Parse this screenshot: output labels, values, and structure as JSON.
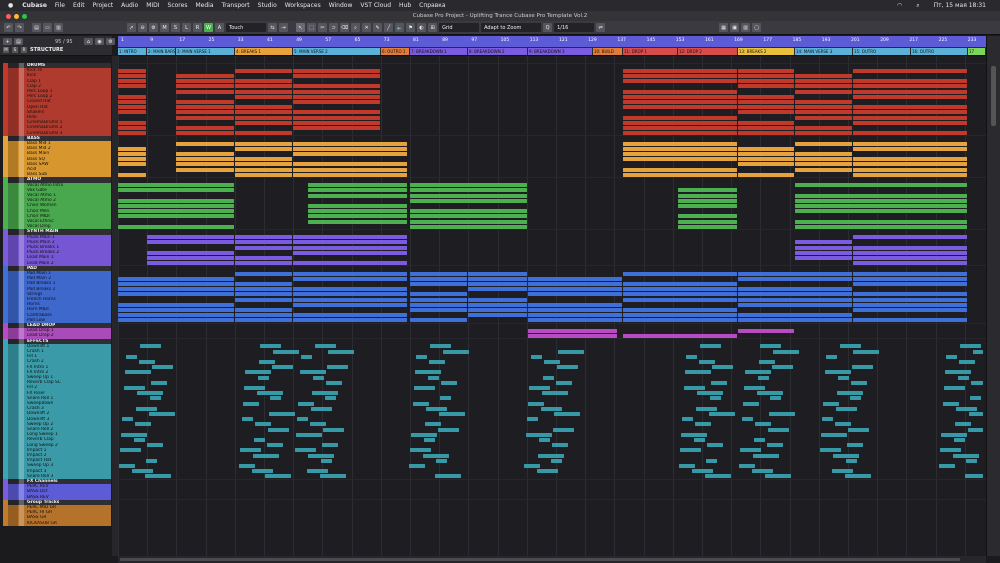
{
  "menubar": {
    "apple": "",
    "app": "Cubase",
    "items": [
      "File",
      "Edit",
      "Project",
      "Audio",
      "MIDI",
      "Scores",
      "Media",
      "Transport",
      "Studio",
      "Workspaces",
      "Window",
      "VST Cloud",
      "Hub",
      "Справка"
    ],
    "clock": "Пт, 15 мая 18:31"
  },
  "window": {
    "title": "Cubase Pro Project - Uplifting Trance Cubase Pro Template Vol.2"
  },
  "toolbar": {
    "automation_mode": "Touch",
    "snap_type": "Grid",
    "zoom_mode": "Adapt to Zoom",
    "quantize": "1/16",
    "buttons": [
      "M",
      "S",
      "L",
      "R",
      "W",
      "A"
    ]
  },
  "tracklist": {
    "count": "95 / 95",
    "header_label": "STRUCTURE"
  },
  "colors": {
    "accent": "#5d5bd6",
    "drums": "#c0392b",
    "bass": "#e6a23c",
    "atmo": "#4caf50",
    "synth": "#7b5be0",
    "pad": "#3f6fd8",
    "lead": "#b84bc4",
    "fx": "#3aa5b5"
  },
  "ruler": {
    "bars": [
      "1",
      "9",
      "17",
      "25",
      "33",
      "41",
      "49",
      "57",
      "65",
      "73",
      "81",
      "89",
      "97",
      "105",
      "113",
      "121",
      "129",
      "137",
      "145",
      "153",
      "161",
      "169",
      "177",
      "185",
      "193",
      "201",
      "209",
      "217",
      "225",
      "233"
    ],
    "markers": [
      {
        "label": "1: INTRO",
        "color": "#5ab0d6"
      },
      {
        "label": "2: MAIN BARS",
        "color": "#5ab0d6"
      },
      {
        "label": "3: MAIN VERSE 1",
        "color": "#5ab0d6"
      },
      {
        "label": "4: BREAKS 1",
        "color": "#e8a23c"
      },
      {
        "label": "5: MAIN VERSE 2",
        "color": "#5ab0d6"
      },
      {
        "label": "6: OUTRO 1",
        "color": "#e07b39"
      },
      {
        "label": "7: BREAKDOWN 1",
        "color": "#7b5be0"
      },
      {
        "label": "8: BREAKDOWN 2",
        "color": "#7b5be0"
      },
      {
        "label": "9: BREAKDOWN 3",
        "color": "#7b5be0"
      },
      {
        "label": "10: BUILD",
        "color": "#e07b39"
      },
      {
        "label": "11: DROP 1",
        "color": "#d84b4b"
      },
      {
        "label": "12: DROP 2",
        "color": "#d84b4b"
      },
      {
        "label": "13: BREAKS 2",
        "color": "#e8c03c"
      },
      {
        "label": "14: MAIN VERSE 3",
        "color": "#5ab0d6"
      },
      {
        "label": "15: OUTRO",
        "color": "#5ab0d6"
      },
      {
        "label": "16: OUTRO",
        "color": "#5ab0d6"
      },
      {
        "label": "17",
        "color": "#7bd65a"
      }
    ]
  },
  "tracks": [
    {
      "name": "DRUMS",
      "group": "drums",
      "folder": true
    },
    {
      "name": "Kick Hi",
      "group": "drums"
    },
    {
      "name": "Kick",
      "group": "drums"
    },
    {
      "name": "Clap 1",
      "group": "drums"
    },
    {
      "name": "Clap 2",
      "group": "drums"
    },
    {
      "name": "Perc Loop 1",
      "group": "drums"
    },
    {
      "name": "Perc Loop 2",
      "group": "drums"
    },
    {
      "name": "Closed Hat",
      "group": "drums"
    },
    {
      "name": "Open Hat",
      "group": "drums"
    },
    {
      "name": "Shakers",
      "group": "drums"
    },
    {
      "name": "Ride",
      "group": "drums"
    },
    {
      "name": "CinemaDrums 1",
      "group": "drums"
    },
    {
      "name": "CinemaDrums 2",
      "group": "drums"
    },
    {
      "name": "CinemaDrums 3",
      "group": "drums"
    },
    {
      "name": "BASS",
      "group": "bass",
      "folder": true
    },
    {
      "name": "Bass Mid 1",
      "group": "bass"
    },
    {
      "name": "Bass Mid 2",
      "group": "bass"
    },
    {
      "name": "Bass Main",
      "group": "bass"
    },
    {
      "name": "Bass SQ",
      "group": "bass"
    },
    {
      "name": "Bass SAW",
      "group": "bass"
    },
    {
      "name": "Acid",
      "group": "bass"
    },
    {
      "name": "Bass Sub",
      "group": "bass"
    },
    {
      "name": "ATMO",
      "group": "atmo",
      "folder": true
    },
    {
      "name": "Vocal Atmo Intro",
      "group": "atmo"
    },
    {
      "name": "Vox Gate",
      "group": "atmo"
    },
    {
      "name": "Vocal Atmo 1",
      "group": "atmo"
    },
    {
      "name": "Vocal Atmo 2",
      "group": "atmo"
    },
    {
      "name": "Choir Women",
      "group": "atmo"
    },
    {
      "name": "Choir Men",
      "group": "atmo"
    },
    {
      "name": "Choir MIDI",
      "group": "atmo"
    },
    {
      "name": "Vocal Ethnic",
      "group": "atmo"
    },
    {
      "name": "Vocal Drop",
      "group": "atmo"
    },
    {
      "name": "SYNTH MAIN",
      "group": "synth",
      "folder": true
    },
    {
      "name": "Pluck Main 1",
      "group": "synth"
    },
    {
      "name": "Pluck Main 2",
      "group": "synth"
    },
    {
      "name": "Pluck Breaks 1",
      "group": "synth"
    },
    {
      "name": "Pluck Breaks 2",
      "group": "synth"
    },
    {
      "name": "Lead Main 1",
      "group": "synth"
    },
    {
      "name": "Lead Main 2",
      "group": "synth"
    },
    {
      "name": "PAD",
      "group": "pad",
      "folder": true
    },
    {
      "name": "Pad Main 1",
      "group": "pad"
    },
    {
      "name": "Pad Main 2",
      "group": "pad"
    },
    {
      "name": "Pad Breaks 1",
      "group": "pad"
    },
    {
      "name": "Pad Breaks 2",
      "group": "pad"
    },
    {
      "name": "Strings",
      "group": "pad"
    },
    {
      "name": "French Horns",
      "group": "pad"
    },
    {
      "name": "Horns",
      "group": "pad"
    },
    {
      "name": "Horn MIDI",
      "group": "pad"
    },
    {
      "name": "Contrabass",
      "group": "pad"
    },
    {
      "name": "Pad Low",
      "group": "pad"
    },
    {
      "name": "LEAD DROP",
      "group": "lead",
      "folder": true
    },
    {
      "name": "Lead Drop 1",
      "group": "lead"
    },
    {
      "name": "Lead Drop 2",
      "group": "lead"
    },
    {
      "name": "EFFECTS",
      "group": "fx",
      "folder": true
    },
    {
      "name": "Downlift 1",
      "group": "fx"
    },
    {
      "name": "Crash 1",
      "group": "fx"
    },
    {
      "name": "Fill 1",
      "group": "fx"
    },
    {
      "name": "Crash 2",
      "group": "fx"
    },
    {
      "name": "FX Intro 1",
      "group": "fx"
    },
    {
      "name": "FX Intro 2",
      "group": "fx"
    },
    {
      "name": "Sweep Up 1",
      "group": "fx"
    },
    {
      "name": "Reverb Clap SC",
      "group": "fx"
    },
    {
      "name": "Fill 2",
      "group": "fx"
    },
    {
      "name": "FX Riser",
      "group": "fx"
    },
    {
      "name": "Snare Roll 1",
      "group": "fx"
    },
    {
      "name": "Sweepdown",
      "group": "fx"
    },
    {
      "name": "Crash 3",
      "group": "fx"
    },
    {
      "name": "Downlift 2",
      "group": "fx"
    },
    {
      "name": "Downlift 3",
      "group": "fx"
    },
    {
      "name": "Sweep Up 2",
      "group": "fx"
    },
    {
      "name": "Snare Roll 2",
      "group": "fx"
    },
    {
      "name": "Long Sweep 1",
      "group": "fx"
    },
    {
      "name": "Reverb Clap",
      "group": "fx"
    },
    {
      "name": "Long Sweep 2",
      "group": "fx"
    },
    {
      "name": "Impact 1",
      "group": "fx"
    },
    {
      "name": "Impact 2",
      "group": "fx"
    },
    {
      "name": "Impact Hat",
      "group": "fx"
    },
    {
      "name": "Sweep Up 3",
      "group": "fx"
    },
    {
      "name": "Impact 3",
      "group": "fx"
    },
    {
      "name": "Snare Roll 3",
      "group": "fx"
    },
    {
      "name": "FX Channels",
      "group": "fxch",
      "folder": true
    },
    {
      "name": "PERC REV",
      "group": "fxch"
    },
    {
      "name": "BASS DLY",
      "group": "fxch"
    },
    {
      "name": "BASS REV",
      "group": "fxch"
    },
    {
      "name": "Group Tracks",
      "group": "grp",
      "folder": true
    },
    {
      "name": "PERC MID GR",
      "group": "grp"
    },
    {
      "name": "PERC HI GR",
      "group": "grp"
    },
    {
      "name": "BASS GR",
      "group": "grp"
    },
    {
      "name": "KICKASUB GR",
      "group": "grp"
    }
  ]
}
